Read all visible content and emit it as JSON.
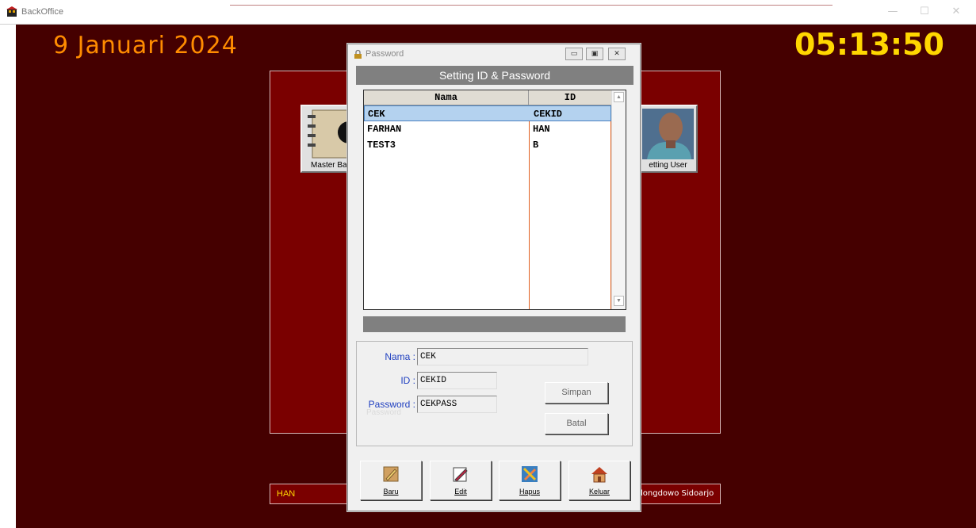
{
  "window": {
    "title": "BackOffice",
    "controls": [
      "—",
      "☐",
      "✕"
    ]
  },
  "desktop": {
    "date": "9 Januari 2024",
    "clock": "05:13:50",
    "tiles": {
      "master_label": "Master Bar",
      "setting_label": "etting User"
    },
    "status_user": "HAN",
    "status_address": "longdowo Sidoarjo"
  },
  "dialog": {
    "title": "Password",
    "header": "Setting ID & Password",
    "grid": {
      "columns": [
        "Nama",
        "ID"
      ],
      "rows": [
        {
          "nama": "CEK",
          "id": "CEKID"
        },
        {
          "nama": "FARHAN",
          "id": "HAN"
        },
        {
          "nama": "TEST3",
          "id": "B"
        }
      ],
      "selected_index": 0
    },
    "form": {
      "nama_label": "Nama :",
      "nama_value": "CEK",
      "id_label": "ID :",
      "id_value": "CEKID",
      "password_label": "Password :",
      "password_value": "CEKPASS",
      "ghost_text": "Password",
      "simpan_label": "Simpan",
      "batal_label": "Batal"
    },
    "actions": [
      {
        "label": "Baru",
        "icon": "new-document-icon"
      },
      {
        "label": "Edit",
        "icon": "edit-icon"
      },
      {
        "label": "Hapus",
        "icon": "delete-icon"
      },
      {
        "label": "Keluar",
        "icon": "home-exit-icon"
      }
    ]
  },
  "colors": {
    "desktop_bg": "#450000",
    "panel_bg": "#7a0000",
    "date_color": "#ff8c00",
    "clock_color": "#ffd700",
    "selected_row": "#b4d2ef"
  }
}
